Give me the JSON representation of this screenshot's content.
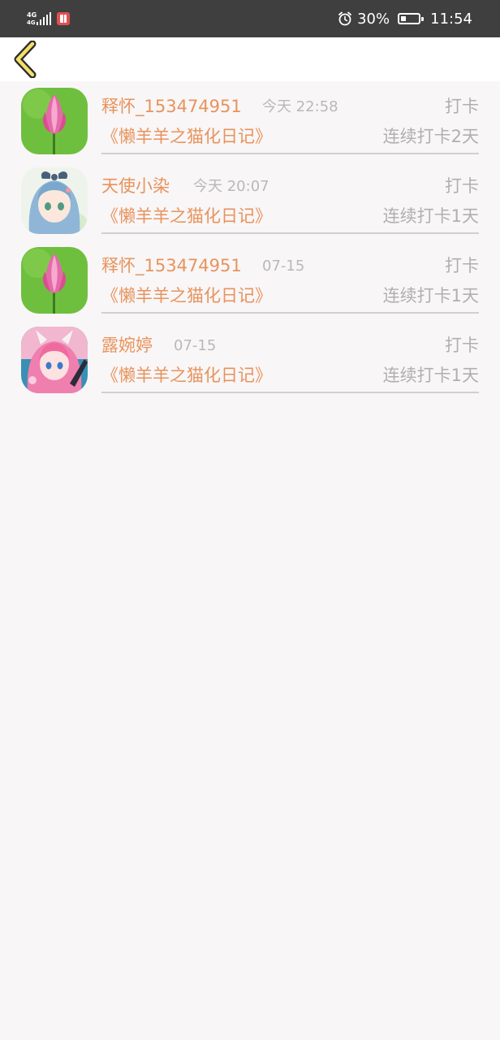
{
  "status_bar": {
    "network_label": "4G",
    "network_sub": "4G",
    "battery_percent": "30%",
    "battery_level": 0.3,
    "time": "11:54",
    "icons": [
      "signal-icon",
      "notification-app-icon",
      "alarm-icon",
      "battery-icon"
    ]
  },
  "header": {
    "back_icon": "chevron-left-icon"
  },
  "items": [
    {
      "name": "释怀_153474951",
      "time": "今天 22:58",
      "action": "打卡",
      "book": "《懒羊羊之猫化日记》",
      "streak": "连续打卡2天",
      "avatar": "lotus-avatar"
    },
    {
      "name": "天使小染",
      "time": "今天 20:07",
      "action": "打卡",
      "book": "《懒羊羊之猫化日记》",
      "streak": "连续打卡1天",
      "avatar": "anime-girl-blue-avatar"
    },
    {
      "name": "释怀_153474951",
      "time": "07-15",
      "action": "打卡",
      "book": "《懒羊羊之猫化日记》",
      "streak": "连续打卡1天",
      "avatar": "lotus-avatar"
    },
    {
      "name": "露婉婷",
      "time": "07-15",
      "action": "打卡",
      "book": "《懒羊羊之猫化日记》",
      "streak": "连续打卡1天",
      "avatar": "anime-girl-pink-avatar"
    }
  ],
  "colors": {
    "accent": "#e8935c",
    "muted": "#b0b0b0",
    "status_bar": "#3f3f3f",
    "background": "#f8f6f7",
    "back_icon_fill": "#f2e06a"
  }
}
